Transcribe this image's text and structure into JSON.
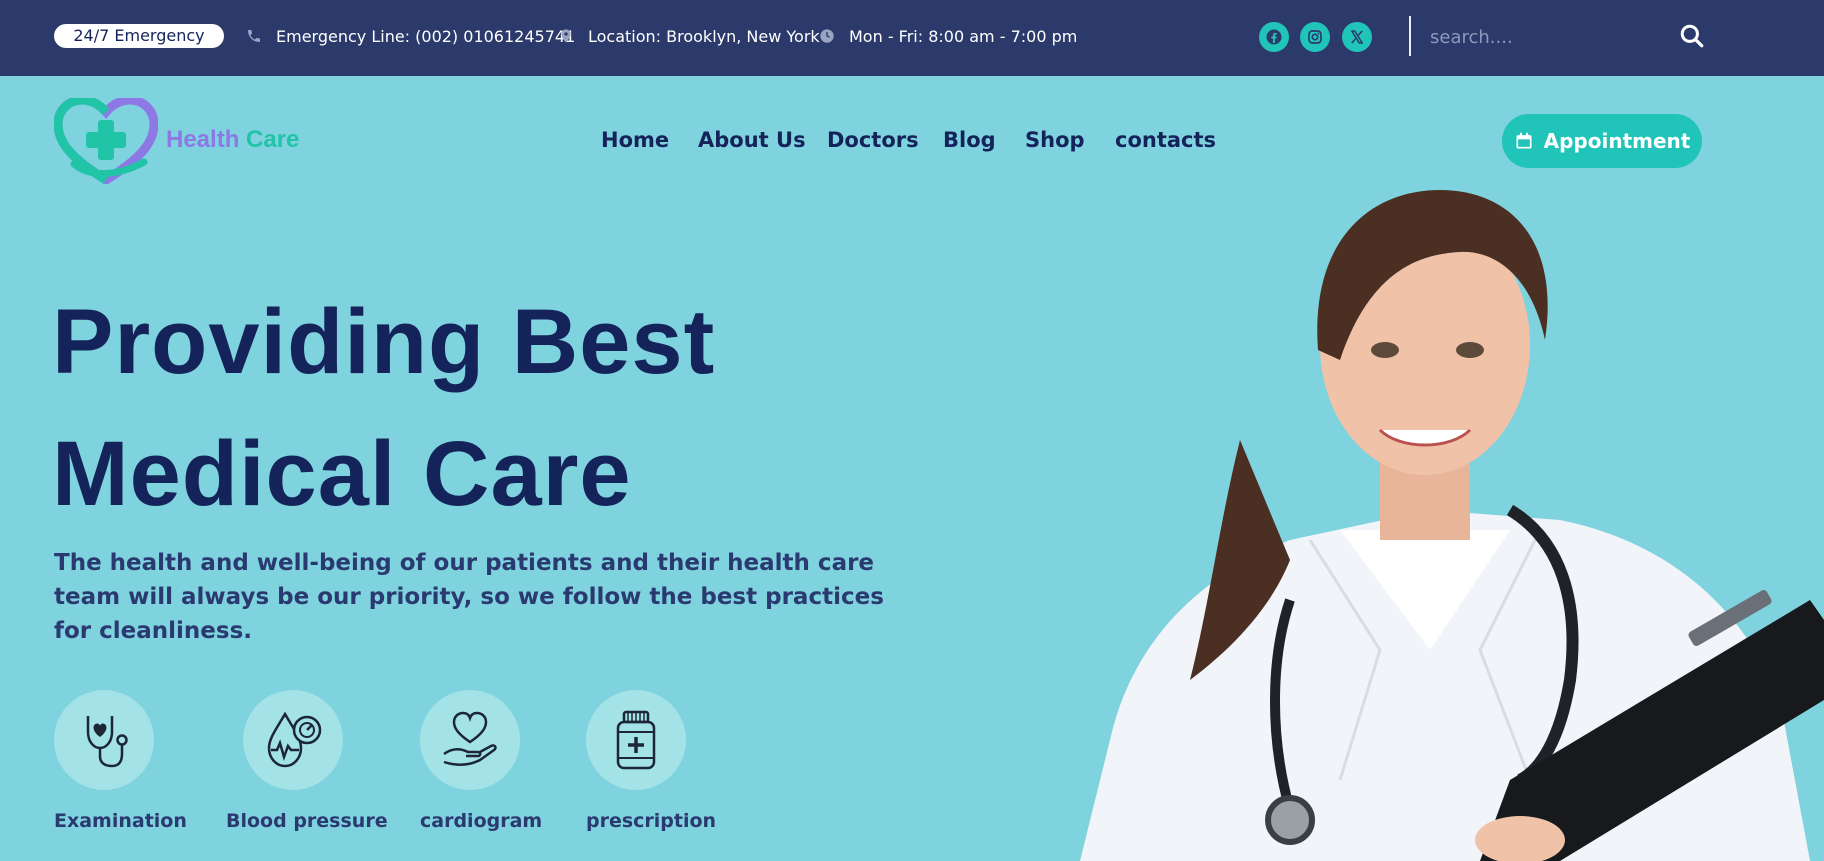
{
  "topbar": {
    "badge": "24/7 Emergency",
    "emergency_line": "Emergency Line: (002) 01061245741",
    "location": "Location: Brooklyn, New York",
    "hours": "Mon - Fri: 8:00 am - 7:00 pm",
    "social": [
      "facebook-icon",
      "instagram-icon",
      "x-icon"
    ],
    "search_placeholder": "search...."
  },
  "header": {
    "brand_part1": "Health",
    "brand_part2": "Care",
    "nav": [
      "Home",
      "About Us",
      "Doctors",
      "Blog",
      "Shop",
      "contacts"
    ],
    "appointment_label": "Appointment"
  },
  "hero": {
    "title_line1": "Providing Best",
    "title_line2": "Medical Care",
    "subtitle": "The health and well-being of our patients and their health care team will always be our priority, so we follow the best practices for cleanliness."
  },
  "services": [
    {
      "label": "Examination",
      "icon": "stethoscope-icon"
    },
    {
      "label": "Blood pressure",
      "icon": "blood-pressure-icon"
    },
    {
      "label": "cardiogram",
      "icon": "heart-hand-icon"
    },
    {
      "label": "prescription",
      "icon": "pill-bottle-icon"
    }
  ],
  "colors": {
    "topbar": "#2b3a6b",
    "accent": "#20c4b8",
    "heading": "#14245a",
    "background": "#7fd3de"
  }
}
